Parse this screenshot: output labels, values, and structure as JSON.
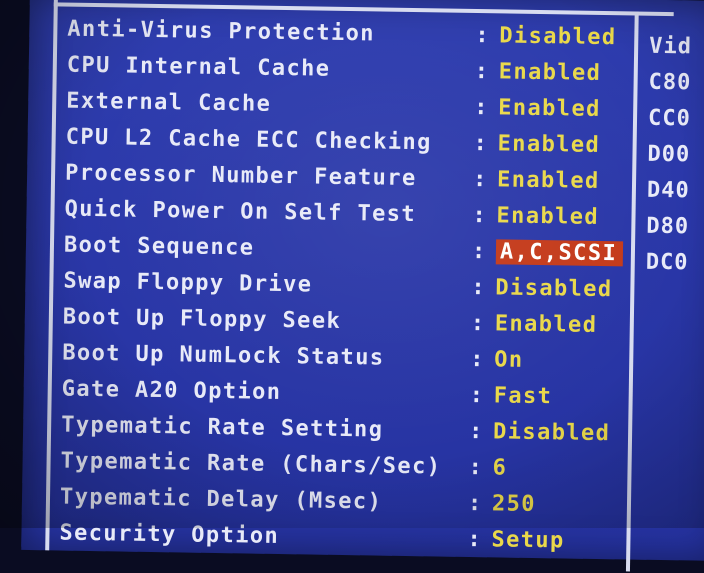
{
  "bios": {
    "settings": [
      {
        "label": "Anti-Virus Protection",
        "value": "Disabled"
      },
      {
        "label": "CPU Internal Cache",
        "value": "Enabled"
      },
      {
        "label": "External Cache",
        "value": "Enabled"
      },
      {
        "label": "CPU L2 Cache ECC Checking",
        "value": "Enabled"
      },
      {
        "label": "Processor Number Feature",
        "value": "Enabled"
      },
      {
        "label": "Quick Power On Self Test",
        "value": "Enabled"
      },
      {
        "label": "Boot Sequence",
        "value": "A,C,SCSI"
      },
      {
        "label": "Swap Floppy Drive",
        "value": "Disabled"
      },
      {
        "label": "Boot Up Floppy Seek",
        "value": "Enabled"
      },
      {
        "label": "Boot Up NumLock Status",
        "value": "On"
      },
      {
        "label": "Gate A20 Option",
        "value": "Fast"
      },
      {
        "label": "Typematic Rate Setting",
        "value": "Disabled"
      },
      {
        "label": "Typematic Rate (Chars/Sec)",
        "value": "6"
      },
      {
        "label": "Typematic Delay (Msec)",
        "value": "250"
      },
      {
        "label": "Security Option",
        "value": "Setup"
      }
    ],
    "separator": ":",
    "selected_label": "Boot Sequence",
    "right_column": [
      "Vid",
      "C80",
      "CC0",
      "D00",
      "D40",
      "D80",
      "DC0"
    ]
  },
  "colors": {
    "background": "#2a37a8",
    "label_text": "#e8eaf8",
    "value_text": "#e9d84a",
    "highlight": "#c43a1a"
  }
}
